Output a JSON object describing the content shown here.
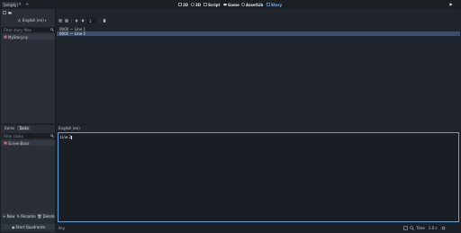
{
  "app": {
    "scene_tab_label": "[empty]",
    "add_tab_symbol": "+",
    "workspaces": [
      {
        "label": "2D",
        "active": false
      },
      {
        "label": "3D",
        "active": false
      },
      {
        "label": "Script",
        "active": false
      },
      {
        "label": "Game",
        "active": false
      },
      {
        "label": "AssetLib",
        "active": false
      },
      {
        "label": "Story",
        "active": true
      }
    ]
  },
  "left_top": {
    "language_label": "English (en)",
    "filter_placeholder": "Filter story files",
    "files": [
      {
        "label": "MyStory.ny"
      }
    ]
  },
  "left_bottom": {
    "tabs": [
      {
        "label": "Items",
        "active": false
      },
      {
        "label": "Tasks",
        "active": true
      }
    ],
    "filter_placeholder": "Filter tasks",
    "items": [
      {
        "label": "ScreenBase"
      }
    ],
    "buttons": {
      "new": "New",
      "rename": "Rename",
      "delete": "Delete"
    },
    "start_label": "Start Quadrante"
  },
  "main": {
    "toolbar_value": "1",
    "list_rows": [
      {
        "label": "0000 — Line 1",
        "selected": false
      },
      {
        "label": "0001 — Line 2",
        "selected": true
      }
    ],
    "editor_header": "English (en)",
    "editor_text": "Line 2"
  },
  "status": {
    "left_label": "Key",
    "time_label": "Time",
    "zoom_value": "1.0 s"
  },
  "colors": {
    "accent": "#7fb4f2",
    "selection": "#3a4f70",
    "editor_border": "#6aa0d8",
    "bg": "#1d2229"
  }
}
